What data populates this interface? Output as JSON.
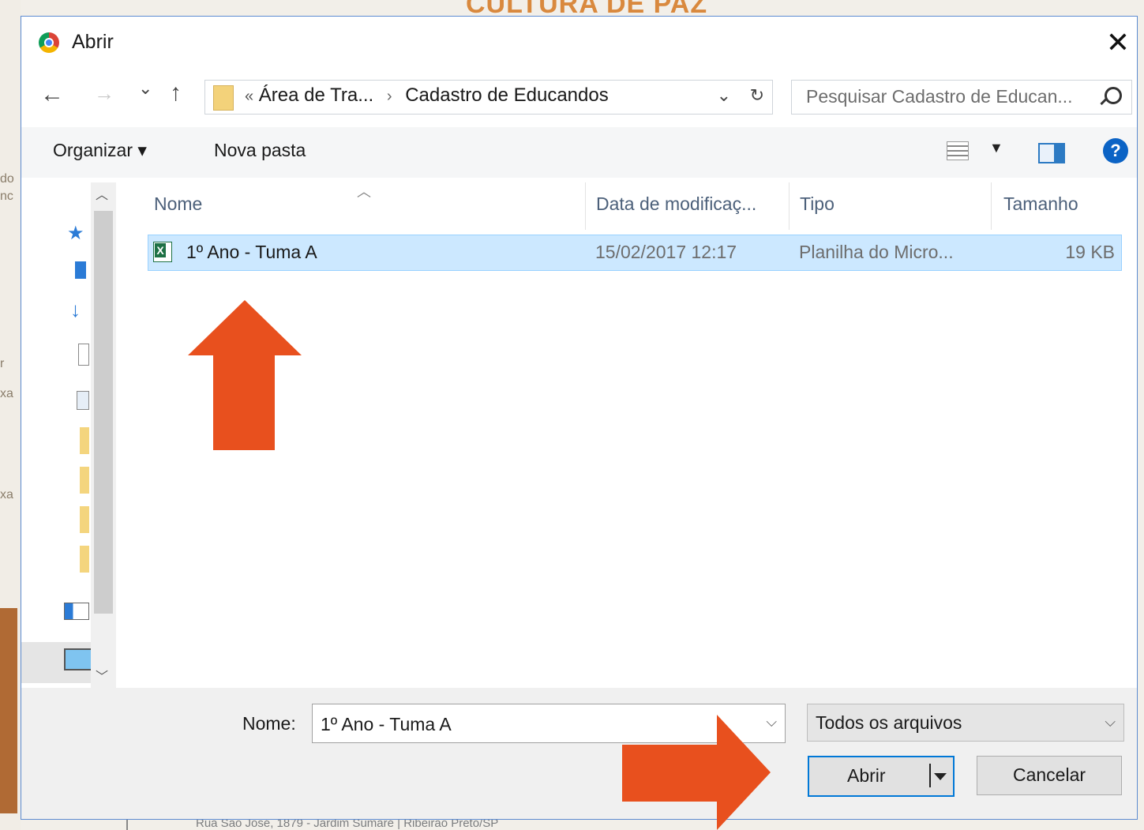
{
  "background": {
    "heading": "CULTURA DE PAZ",
    "fragments": [
      "do",
      "nc",
      "r",
      "xa",
      "",
      "xa"
    ],
    "footer": "Rua São José, 1879 - Jardim Sumaré | Ribeirão Preto/SP"
  },
  "dialog": {
    "title": "Abrir",
    "close_icon": "close-icon",
    "nav": {
      "back": "←",
      "forward": "→",
      "recent": "⌄",
      "up": "↑",
      "breadcrumb_prefix": "«",
      "breadcrumb": [
        "Área de Tra...",
        "Cadastro de Educandos"
      ],
      "search_placeholder": "Pesquisar Cadastro de Educan..."
    },
    "toolbar": {
      "organize": "Organizar ▾",
      "new_folder": "Nova pasta"
    },
    "columns": [
      "Nome",
      "Data de modificaç...",
      "Tipo",
      "Tamanho"
    ],
    "files": [
      {
        "name": "1º Ano - Tuma A",
        "modified": "15/02/2017 12:17",
        "type": "Planilha do Micro...",
        "size": "19 KB",
        "selected": true
      }
    ],
    "footer": {
      "name_label": "Nome:",
      "name_value": "1º Ano - Tuma A",
      "filter_value": "Todos os arquivos",
      "open_button": "Abrir",
      "cancel_button": "Cancelar"
    }
  },
  "colors": {
    "accent": "#0078d7",
    "selection": "#cce8ff",
    "annotation_arrow": "#e8501e",
    "background_heading": "#d9893e"
  }
}
